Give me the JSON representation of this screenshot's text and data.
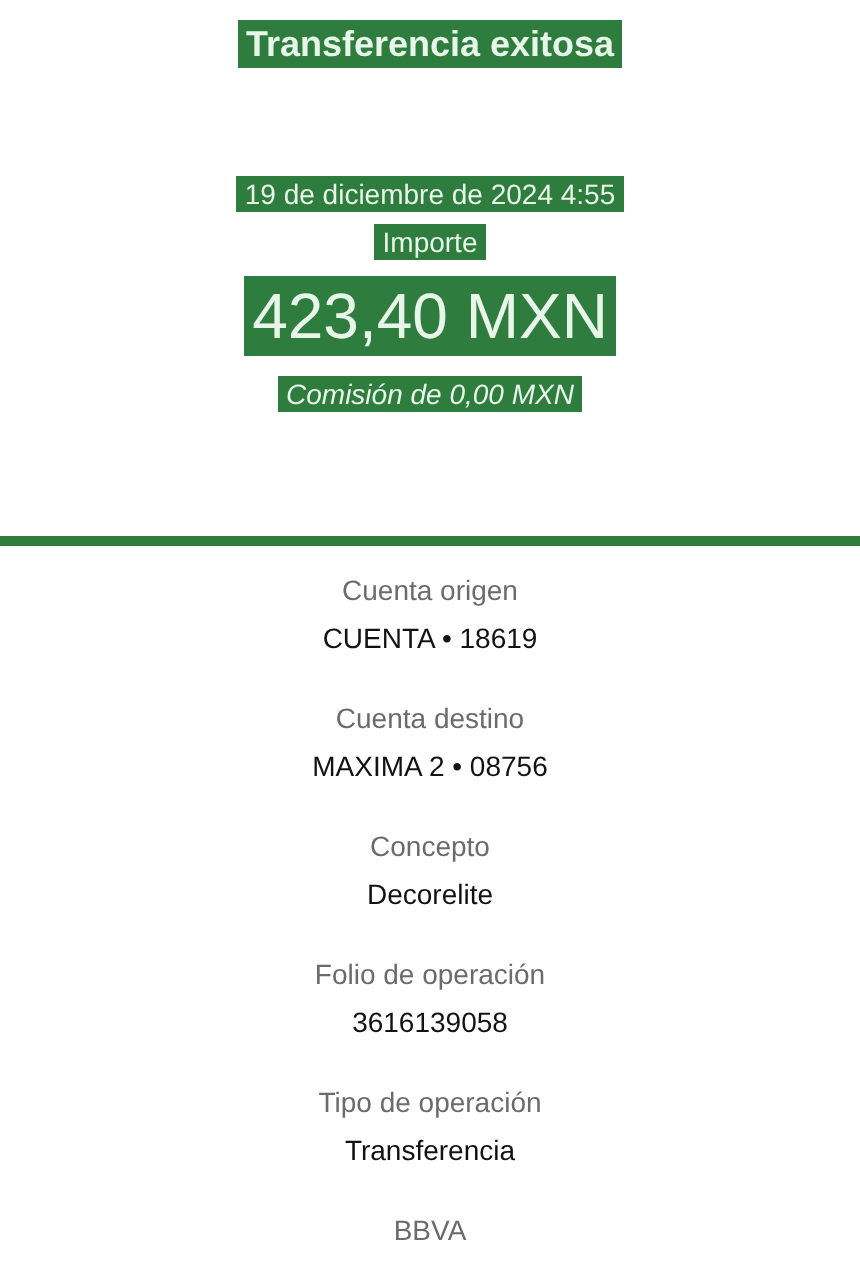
{
  "header": {
    "title": "Transferencia exitosa",
    "date": "19 de diciembre de 2024 4:55",
    "amount_label": "Importe",
    "amount": "423,40 MXN",
    "fee": "Comisión de 0,00 MXN"
  },
  "details": [
    {
      "label": "Cuenta origen",
      "value": "CUENTA • 18619"
    },
    {
      "label": "Cuenta destino",
      "value": "MAXIMA 2 • 08756"
    },
    {
      "label": "Concepto",
      "value": "Decorelite"
    },
    {
      "label": "Folio de operación",
      "value": "3616139058"
    },
    {
      "label": "Tipo de operación",
      "value": "Transferencia"
    }
  ],
  "footer": {
    "bank": "BBVA"
  }
}
